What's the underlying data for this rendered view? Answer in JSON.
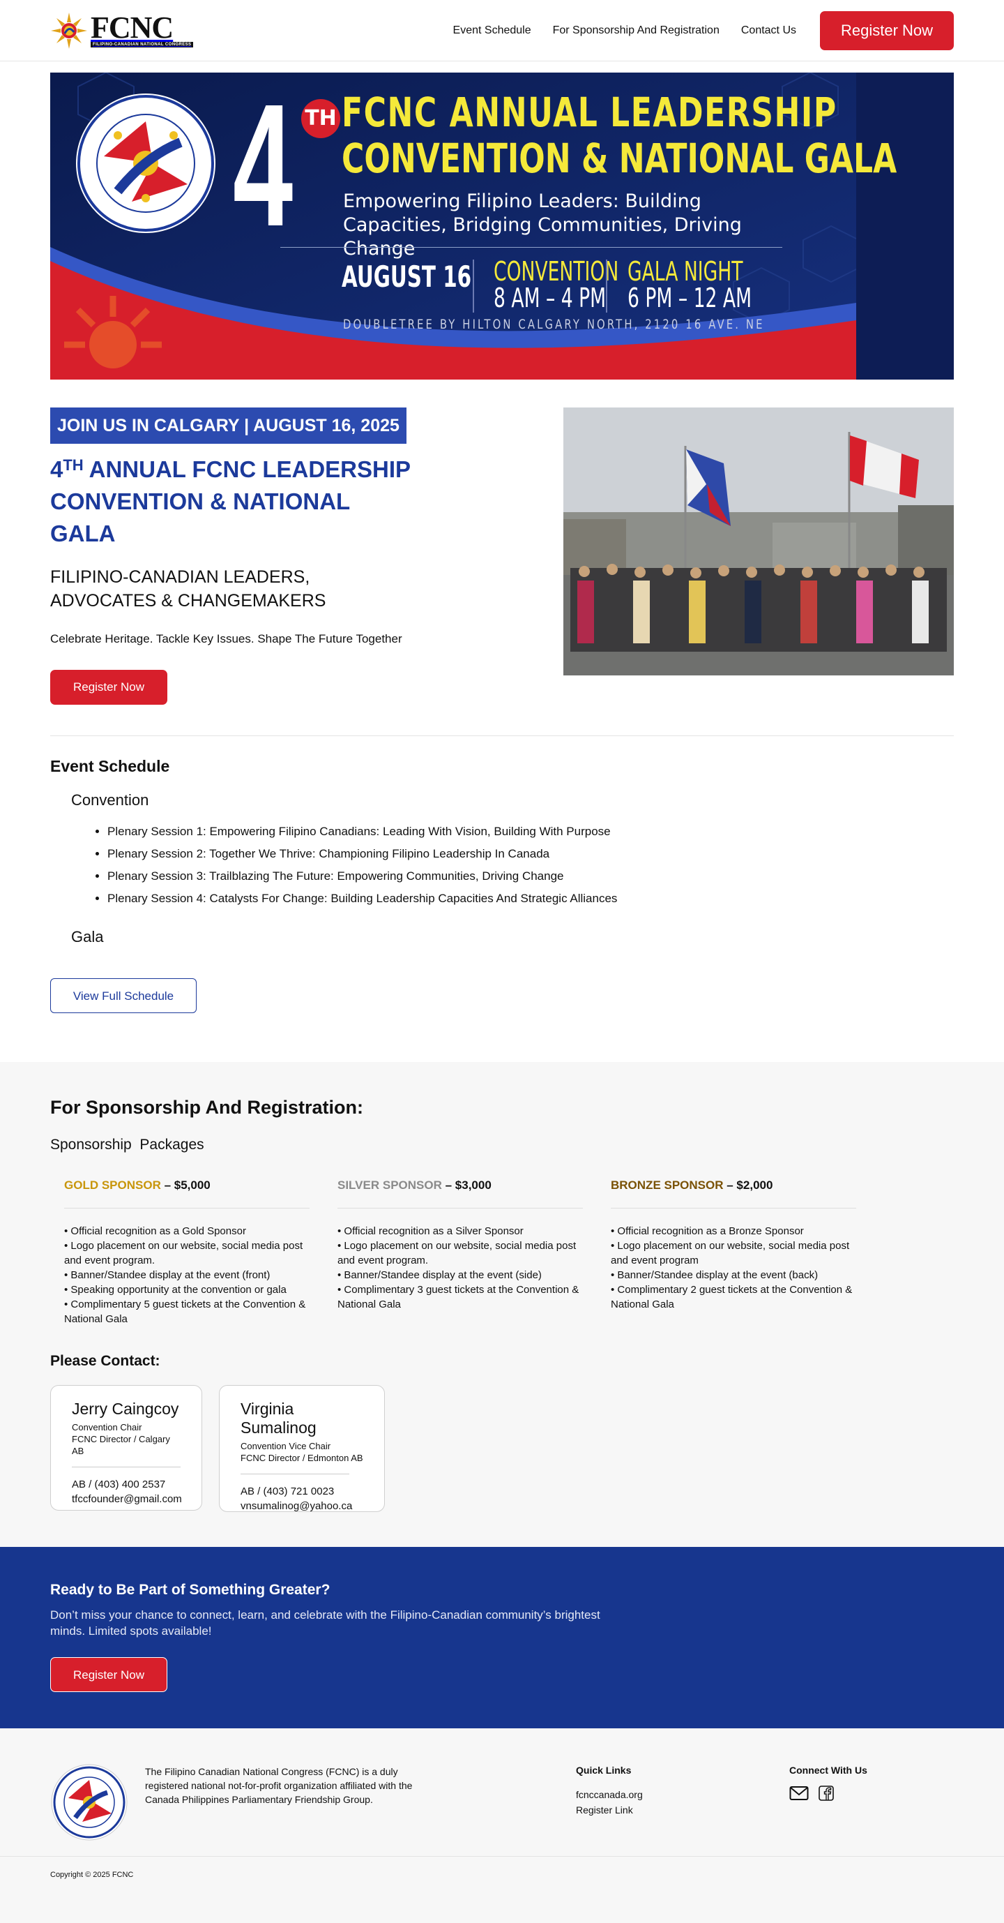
{
  "header": {
    "logo_text": "FCNC",
    "logo_sub": "FILIPINO-CANADIAN NATIONAL CONGRESS",
    "nav": [
      "Event Schedule",
      "For Sponsorship And Registration",
      "Contact Us"
    ],
    "register_label": "Register Now"
  },
  "banner": {
    "number": "4",
    "ordinal": "TH",
    "title_line1": "FCNC ANNUAL LEADERSHIP",
    "title_line2": "CONVENTION & NATIONAL GALA",
    "tagline": "Empowering Filipino Leaders: Building Capacities, Bridging Communities, Driving Change",
    "date": "AUGUST 16",
    "convention_label": "CONVENTION",
    "convention_time": "8 AM – 4 PM",
    "gala_label": "GALA NIGHT",
    "gala_time": "6 PM – 12 AM",
    "venue": "DOUBLETREE BY HILTON CALGARY NORTH, 2120 16 AVE. NE",
    "seal_top": "ANNUAL LEADERSHIP CONVENTION",
    "seal_bottom": "FILIPINO CANADIAN NATIONAL CONGRESS"
  },
  "intro": {
    "pill": "JOIN US IN CALGARY | AUGUST 16, 2025",
    "title_number": "4",
    "title_ordinal": "TH",
    "title_rest_line1": " ANNUAL FCNC LEADERSHIP",
    "title_line2": "CONVENTION & NATIONAL GALA",
    "subtitle_line1": "FILIPINO-CANADIAN LEADERS,",
    "subtitle_line2": "ADVOCATES & CHANGEMAKERS",
    "tagline": "Celebrate Heritage. Tackle Key Issues. Shape The Future Together",
    "register_label": "Register Now"
  },
  "schedule": {
    "title": "Event Schedule",
    "convention": "Convention",
    "sessions": [
      "Plenary Session 1: Empowering Filipino Canadians: Leading With Vision, Building With Purpose",
      "Plenary Session 2: Together We Thrive: Championing Filipino Leadership In Canada",
      "Plenary Session 3: Trailblazing The Future: Empowering Communities, Driving Change",
      "Plenary Session 4: Catalysts For Change: Building Leadership Capacities And Strategic Alliances"
    ],
    "gala": "Gala",
    "view_full_label": "View Full Schedule"
  },
  "sponsorship": {
    "title": "For Sponsorship And Registration:",
    "packages_label": "Sponsorship  Packages",
    "tiers": [
      {
        "name": "GOLD SPONSOR",
        "price": " – $5,000",
        "benefits": [
          "• Official recognition as a Gold Sponsor",
          "• Logo placement on our website, social media post and event program.",
          "• Banner/Standee display at the event (front)",
          "• Speaking opportunity at the convention or gala",
          "• Complimentary 5 guest tickets at the Convention & National Gala"
        ]
      },
      {
        "name": "SILVER SPONSOR",
        "price": " – $3,000",
        "benefits": [
          "• Official recognition as a Silver Sponsor",
          "• Logo placement on our website, social media post and event program.",
          "• Banner/Standee display at the event (side)",
          "• Complimentary 3 guest tickets at the Convention & National Gala"
        ]
      },
      {
        "name": "BRONZE SPONSOR",
        "price": " – $2,000",
        "benefits": [
          "• Official recognition as a Bronze Sponsor",
          "• Logo placement on our website, social media post and event program",
          "• Banner/Standee display at the event (back)",
          "• Complimentary 2 guest tickets at the Convention & National Gala"
        ]
      }
    ],
    "contact_title": "Please Contact:",
    "contacts": [
      {
        "name": "Jerry Caingcoy",
        "role1": "Convention Chair",
        "role2": "FCNC Director / Calgary AB",
        "phone": "AB / (403) 400 2537",
        "email": "tfccfounder@gmail.com"
      },
      {
        "name": "Virginia Sumalinog",
        "role1": "Convention Vice Chair",
        "role2": "FCNC Director / Edmonton AB",
        "phone": "AB / (403) 721 0023",
        "email": "vnsumalinog@yahoo.ca"
      }
    ]
  },
  "cta": {
    "title": "Ready to Be Part of Something Greater?",
    "text": "Don’t miss your chance to connect, learn, and celebrate with the Filipino-Canadian community’s brightest minds. Limited spots available!",
    "register_label": "Register Now"
  },
  "footer": {
    "about": "The Filipino Canadian National Congress (FCNC) is a duly registered national not-for-profit organization affiliated with the Canada Philippines Parliamentary Friendship Group.",
    "quick_links_title": "Quick Links",
    "links": [
      "fcnccanada.org",
      "Register Link"
    ],
    "connect_title": "Connect With Us",
    "icons": [
      "mail-icon",
      "facebook-icon"
    ],
    "copyright": "Copyright © 2025 FCNC"
  },
  "colors": {
    "brand_red": "#d71f2b",
    "brand_blue": "#17368e",
    "heading_blue": "#1c3a9b",
    "banner_yellow": "#f5e93a",
    "gold": "#c8960c",
    "silver": "#8a8a8a",
    "bronze": "#7a5206"
  }
}
